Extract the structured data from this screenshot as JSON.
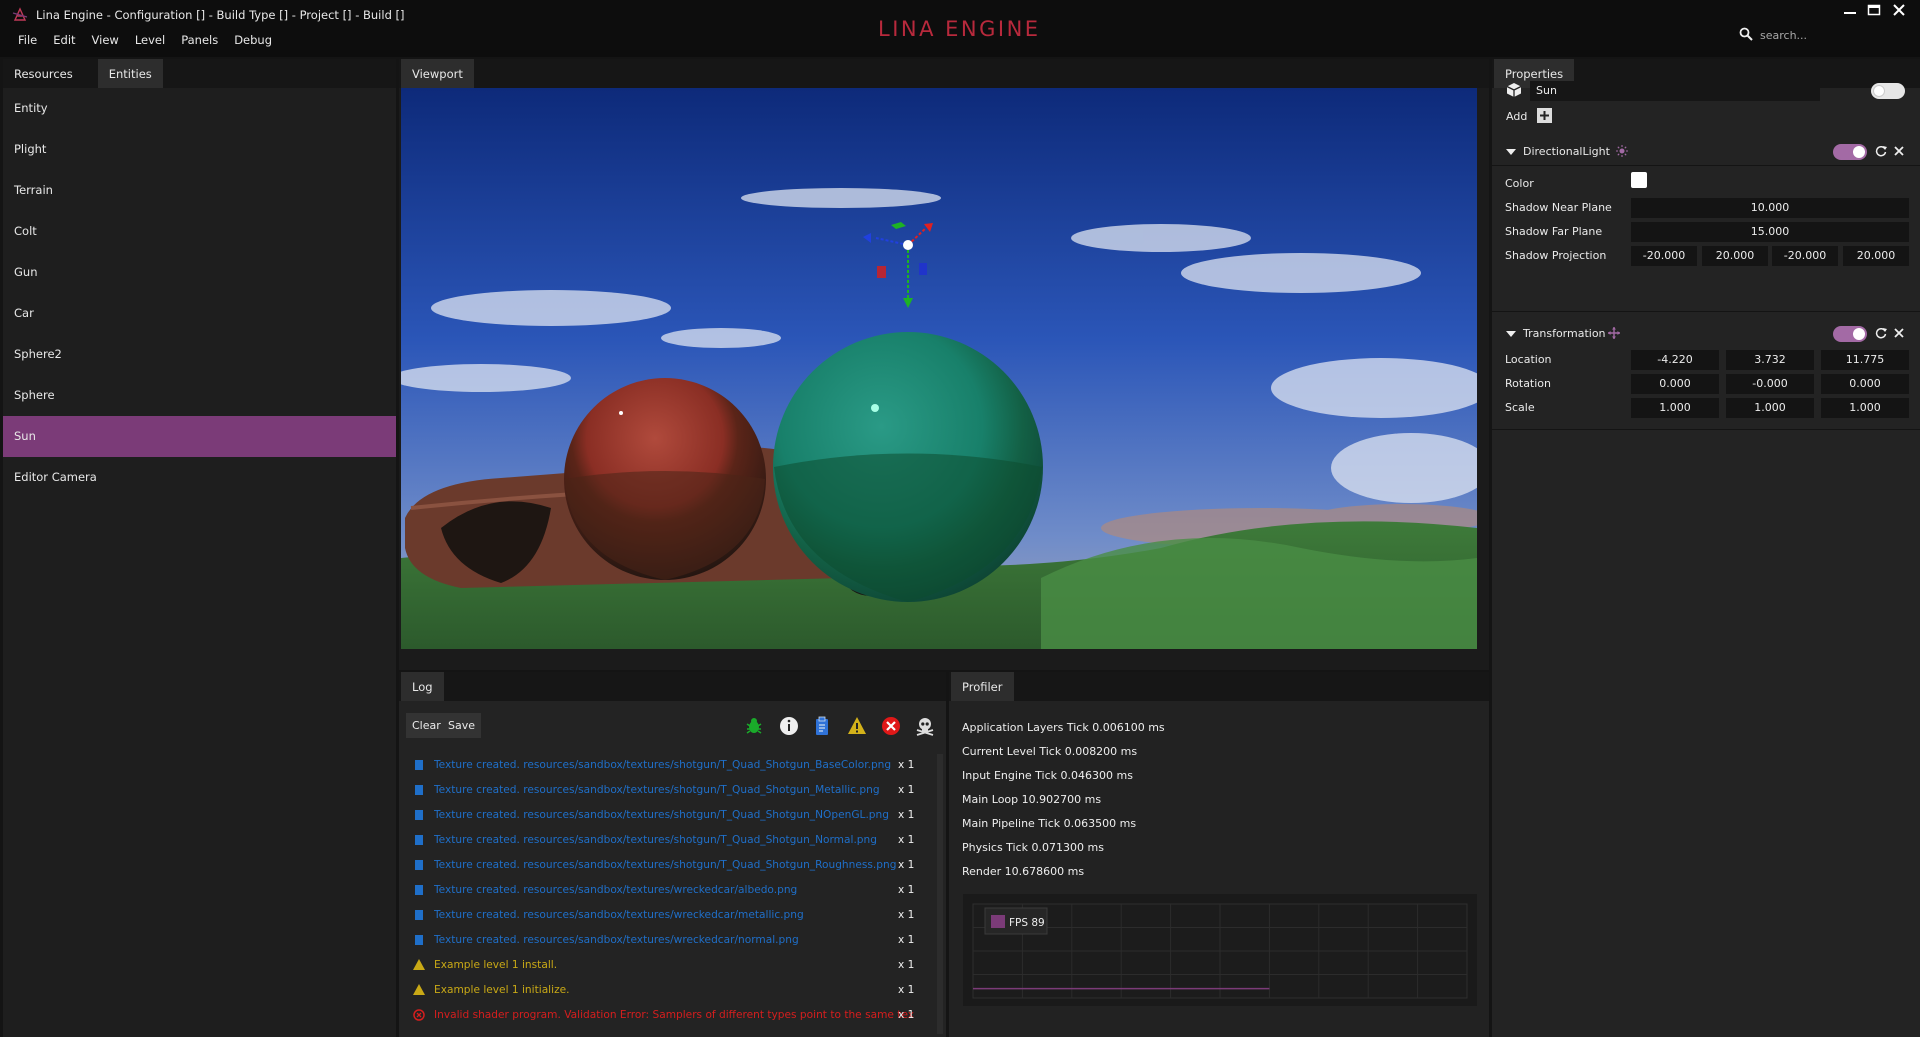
{
  "window": {
    "title": "Lina Engine - Configuration [] - Build Type [] - Project [] - Build []",
    "brand": "LINA ENGINE"
  },
  "menu": [
    "File",
    "Edit",
    "View",
    "Level",
    "Panels",
    "Debug"
  ],
  "search": {
    "placeholder": "search..."
  },
  "left_panel": {
    "tabs": [
      "Resources",
      "Entities"
    ],
    "active_tab": "Entities",
    "entities": [
      "Entity",
      "Plight",
      "Terrain",
      "Colt",
      "Gun",
      "Car",
      "Sphere2",
      "Sphere",
      "Sun",
      "Editor Camera"
    ],
    "selected": "Sun"
  },
  "viewport": {
    "tab": "Viewport"
  },
  "log": {
    "tab": "Log",
    "clear_label": "Clear",
    "save_label": "Save",
    "filter_icons": [
      "bug-icon",
      "info-icon",
      "clipboard-icon",
      "warning-icon",
      "error-icon",
      "skull-icon"
    ],
    "entries": [
      {
        "level": "trace",
        "text": "Texture created. resources/sandbox/textures/shotgun/T_Quad_Shotgun_BaseColor.png",
        "count": "x 1"
      },
      {
        "level": "trace",
        "text": "Texture created. resources/sandbox/textures/shotgun/T_Quad_Shotgun_Metallic.png",
        "count": "x 1"
      },
      {
        "level": "trace",
        "text": "Texture created. resources/sandbox/textures/shotgun/T_Quad_Shotgun_NOpenGL.png",
        "count": "x 1"
      },
      {
        "level": "trace",
        "text": "Texture created. resources/sandbox/textures/shotgun/T_Quad_Shotgun_Normal.png",
        "count": "x 1"
      },
      {
        "level": "trace",
        "text": "Texture created. resources/sandbox/textures/shotgun/T_Quad_Shotgun_Roughness.png",
        "count": "x 1"
      },
      {
        "level": "trace",
        "text": "Texture created. resources/sandbox/textures/wreckedcar/albedo.png",
        "count": "x 1"
      },
      {
        "level": "trace",
        "text": "Texture created. resources/sandbox/textures/wreckedcar/metallic.png",
        "count": "x 1"
      },
      {
        "level": "trace",
        "text": "Texture created. resources/sandbox/textures/wreckedcar/normal.png",
        "count": "x 1"
      },
      {
        "level": "warning",
        "text": "Example level 1 install.",
        "count": "x 1"
      },
      {
        "level": "warning",
        "text": "Example level 1 initialize.",
        "count": "x 1"
      },
      {
        "level": "error",
        "text": "Invalid shader program. Validation Error: Samplers of different types point to the same texture unit.",
        "count": "x 1"
      }
    ],
    "colors": {
      "trace": "#1f6fc9",
      "warning": "#c9a916",
      "error": "#d61e1e"
    }
  },
  "profiler": {
    "tab": "Profiler",
    "lines": [
      "Application Layers Tick 0.006100 ms",
      "Current Level Tick 0.008200 ms",
      "Input Engine Tick 0.046300 ms",
      "Main Loop 10.902700 ms",
      "Main Pipeline Tick 0.063500 ms",
      "Physics Tick 0.071300 ms",
      "Render 10.678600 ms"
    ],
    "fps_label": "FPS 89"
  },
  "chart_data": {
    "type": "line",
    "title": "",
    "xlabel": "",
    "ylabel": "",
    "series": [
      {
        "name": "FPS 89",
        "values": [
          89,
          89,
          89,
          89,
          89,
          89,
          89,
          89,
          89,
          89,
          89
        ]
      }
    ],
    "grid": true,
    "legend": "top-left"
  },
  "properties": {
    "tab": "Properties",
    "entity_name": "Sun",
    "add_label": "Add",
    "directional_light": {
      "title": "DirectionalLight",
      "color_label": "Color",
      "color_value": "#ffffff",
      "near_label": "Shadow Near Plane",
      "near_value": "10.000",
      "far_label": "Shadow Far Plane",
      "far_value": "15.000",
      "proj_label": "Shadow Projection",
      "proj_values": [
        "-20.000",
        "20.000",
        "-20.000",
        "20.000"
      ]
    },
    "transformation": {
      "title": "Transformation",
      "location_label": "Location",
      "location": [
        "-4.220",
        "3.732",
        "11.775"
      ],
      "rotation_label": "Rotation",
      "rotation": [
        "0.000",
        "-0.000",
        "0.000"
      ],
      "scale_label": "Scale",
      "scale": [
        "1.000",
        "1.000",
        "1.000"
      ]
    }
  },
  "colors": {
    "accent": "#7b3b78",
    "toggle_on": "#a36aa5",
    "brand": "#b8293c"
  }
}
